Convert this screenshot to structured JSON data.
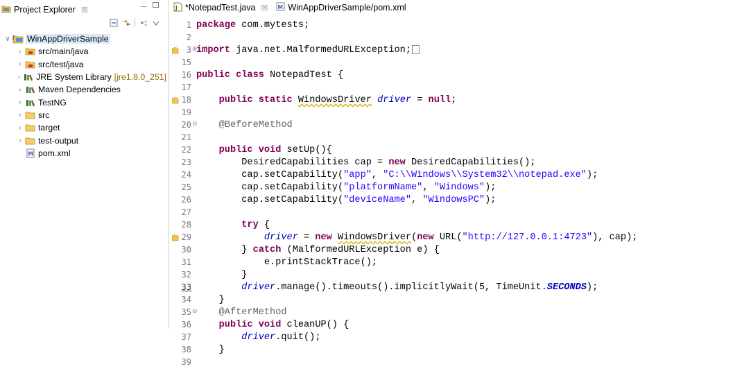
{
  "explorer": {
    "title": "Project Explorer",
    "close_symbol": "☒",
    "minimize_symbol": "─",
    "tree": [
      {
        "label": "WinAppDriverSample",
        "twisty": "∨",
        "icon": "java-project-icon",
        "selected": true,
        "indent": 0
      },
      {
        "label": "src/main/java",
        "twisty": "›",
        "icon": "source-folder-icon",
        "indent": 1
      },
      {
        "label": "src/test/java",
        "twisty": "›",
        "icon": "source-folder-icon",
        "indent": 1
      },
      {
        "label": "JRE System Library",
        "decoration": "[jre1.8.0_251]",
        "twisty": "›",
        "icon": "library-icon",
        "indent": 1
      },
      {
        "label": "Maven Dependencies",
        "twisty": "›",
        "icon": "library-icon",
        "indent": 1
      },
      {
        "label": "TestNG",
        "twisty": "›",
        "icon": "library-icon",
        "indent": 1
      },
      {
        "label": "src",
        "twisty": "›",
        "icon": "folder-icon",
        "indent": 1
      },
      {
        "label": "target",
        "twisty": "›",
        "icon": "folder-icon",
        "indent": 1
      },
      {
        "label": "test-output",
        "twisty": "›",
        "icon": "folder-icon",
        "indent": 1
      },
      {
        "label": "pom.xml",
        "twisty": "",
        "icon": "xml-file-icon",
        "indent": 1
      }
    ]
  },
  "editor": {
    "tabs": [
      {
        "label": "*NotepadTest.java",
        "close": "☒",
        "icon": "java-file-icon",
        "active": true
      },
      {
        "label": "WinAppDriverSample/pom.xml",
        "close": "",
        "icon": "xml-file-icon",
        "active": false
      }
    ],
    "lines": [
      {
        "n": "1",
        "tokens": [
          [
            "kw",
            "package"
          ],
          [
            "t",
            " com.mytests;"
          ]
        ]
      },
      {
        "n": "2",
        "tokens": []
      },
      {
        "n": "3",
        "fold": "⊕",
        "marker": "warning",
        "collapsed": true,
        "tokens": [
          [
            "kw",
            "import"
          ],
          [
            "t",
            " java.net.MalformedURLException;"
          ]
        ]
      },
      {
        "n": "15",
        "tokens": []
      },
      {
        "n": "16",
        "tokens": [
          [
            "kw",
            "public class"
          ],
          [
            "t",
            " NotepadTest {"
          ]
        ]
      },
      {
        "n": "17",
        "tokens": []
      },
      {
        "n": "18",
        "marker": "warning",
        "tokens": [
          [
            "t",
            "    "
          ],
          [
            "kw",
            "public static"
          ],
          [
            "t",
            " "
          ],
          [
            "wavy",
            "WindowsDriver"
          ],
          [
            "t",
            " "
          ],
          [
            "fld",
            "driver"
          ],
          [
            "t",
            " = "
          ],
          [
            "kw",
            "null"
          ],
          [
            "t",
            ";"
          ]
        ]
      },
      {
        "n": "19",
        "tokens": []
      },
      {
        "n": "20",
        "fold": "⊖",
        "tokens": [
          [
            "t",
            "    "
          ],
          [
            "ann",
            "@BeforeMethod"
          ]
        ]
      },
      {
        "n": "21",
        "tokens": []
      },
      {
        "n": "22",
        "tokens": [
          [
            "t",
            "    "
          ],
          [
            "kw",
            "public void"
          ],
          [
            "t",
            " setUp(){"
          ]
        ]
      },
      {
        "n": "23",
        "tokens": [
          [
            "t",
            "        DesiredCapabilities cap = "
          ],
          [
            "kw",
            "new"
          ],
          [
            "t",
            " DesiredCapabilities();"
          ]
        ]
      },
      {
        "n": "24",
        "tokens": [
          [
            "t",
            "        cap.setCapability("
          ],
          [
            "str",
            "\"app\""
          ],
          [
            "t",
            ", "
          ],
          [
            "str",
            "\"C:\\\\Windows\\\\System32\\\\notepad.exe\""
          ],
          [
            "t",
            ");"
          ]
        ]
      },
      {
        "n": "25",
        "tokens": [
          [
            "t",
            "        cap.setCapability("
          ],
          [
            "str",
            "\"platformName\""
          ],
          [
            "t",
            ", "
          ],
          [
            "str",
            "\"Windows\""
          ],
          [
            "t",
            ");"
          ]
        ]
      },
      {
        "n": "26",
        "tokens": [
          [
            "t",
            "        cap.setCapability("
          ],
          [
            "str",
            "\"deviceName\""
          ],
          [
            "t",
            ", "
          ],
          [
            "str",
            "\"WindowsPC\""
          ],
          [
            "t",
            ");"
          ]
        ]
      },
      {
        "n": "27",
        "tokens": []
      },
      {
        "n": "28",
        "tokens": [
          [
            "t",
            "        "
          ],
          [
            "kw",
            "try"
          ],
          [
            "t",
            " {"
          ]
        ]
      },
      {
        "n": "29",
        "marker": "warning",
        "tokens": [
          [
            "t",
            "            "
          ],
          [
            "fld",
            "driver"
          ],
          [
            "t",
            " = "
          ],
          [
            "kw",
            "new"
          ],
          [
            "t",
            " "
          ],
          [
            "wavy",
            "WindowsDriver"
          ],
          [
            "t",
            "("
          ],
          [
            "kw",
            "new"
          ],
          [
            "t",
            " URL("
          ],
          [
            "str",
            "\"http://127.0.0.1:4723\""
          ],
          [
            "t",
            "), cap);"
          ]
        ]
      },
      {
        "n": "30",
        "tokens": [
          [
            "t",
            "        } "
          ],
          [
            "kw",
            "catch"
          ],
          [
            "t",
            " (MalformedURLException e) {"
          ]
        ]
      },
      {
        "n": "31",
        "tokens": [
          [
            "t",
            "            e.printStackTrace();"
          ]
        ]
      },
      {
        "n": "32",
        "tokens": [
          [
            "t",
            "        }"
          ]
        ]
      },
      {
        "n": "33",
        "current": true,
        "tokens": [
          [
            "t",
            "        "
          ],
          [
            "fld",
            "driver"
          ],
          [
            "t",
            ".manage().timeouts().implicitlyWait(5, TimeUnit."
          ],
          [
            "cst",
            "SECONDS"
          ],
          [
            "t",
            ");"
          ]
        ]
      },
      {
        "n": "34",
        "tokens": [
          [
            "t",
            "    }"
          ]
        ]
      },
      {
        "n": "35",
        "fold": "⊖",
        "tokens": [
          [
            "t",
            "    "
          ],
          [
            "ann",
            "@AfterMethod"
          ]
        ]
      },
      {
        "n": "36",
        "tokens": [
          [
            "t",
            "    "
          ],
          [
            "kw",
            "public void"
          ],
          [
            "t",
            " cleanUP() {"
          ]
        ]
      },
      {
        "n": "37",
        "tokens": [
          [
            "t",
            "        "
          ],
          [
            "fld",
            "driver"
          ],
          [
            "t",
            ".quit();"
          ]
        ]
      },
      {
        "n": "38",
        "tokens": [
          [
            "t",
            "    }"
          ]
        ]
      },
      {
        "n": "39",
        "tokens": []
      }
    ]
  },
  "colors": {
    "keyword": "#7f0055",
    "string": "#2a00ff",
    "annotation": "#646464",
    "field": "#0000c0",
    "selection": "#dbe8f7"
  }
}
